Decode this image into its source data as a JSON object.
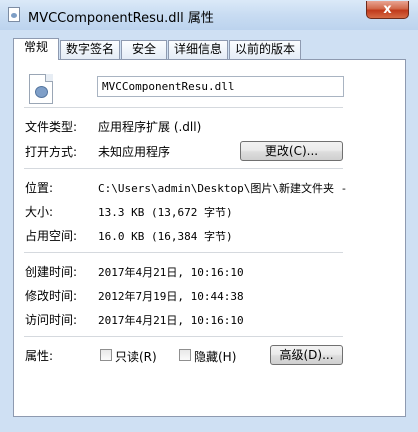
{
  "window": {
    "title": "MVCComponentResu.dll 属性",
    "close_label": "x"
  },
  "tabs": [
    "常规",
    "数字签名",
    "安全",
    "详细信息",
    "以前的版本"
  ],
  "general": {
    "file_name": "MVCComponentResu.dll",
    "file_type_label": "文件类型:",
    "file_type_value": "应用程序扩展 (.dll)",
    "opens_with_label": "打开方式:",
    "opens_with_value": "未知应用程序",
    "change_button": "更改(C)...",
    "location_label": "位置:",
    "location_value": "C:\\Users\\admin\\Desktop\\图片\\新建文件夹 -",
    "size_label": "大小:",
    "size_value": "13.3 KB (13,672 字节)",
    "size_on_disk_label": "占用空间:",
    "size_on_disk_value": "16.0 KB (16,384 字节)",
    "created_label": "创建时间:",
    "created_value": "2017年4月21日, 10:16:10",
    "modified_label": "修改时间:",
    "modified_value": "2012年7月19日, 10:44:38",
    "accessed_label": "访问时间:",
    "accessed_value": "2017年4月21日, 10:16:10",
    "attributes_label": "属性:",
    "readonly_label": "只读(R)",
    "readonly_checked": false,
    "hidden_label": "隐藏(H)",
    "hidden_checked": false,
    "advanced_button": "高级(D)..."
  },
  "icons": {
    "title_icon": "dll-file-icon",
    "file_icon": "dll-file-gear-icon"
  }
}
